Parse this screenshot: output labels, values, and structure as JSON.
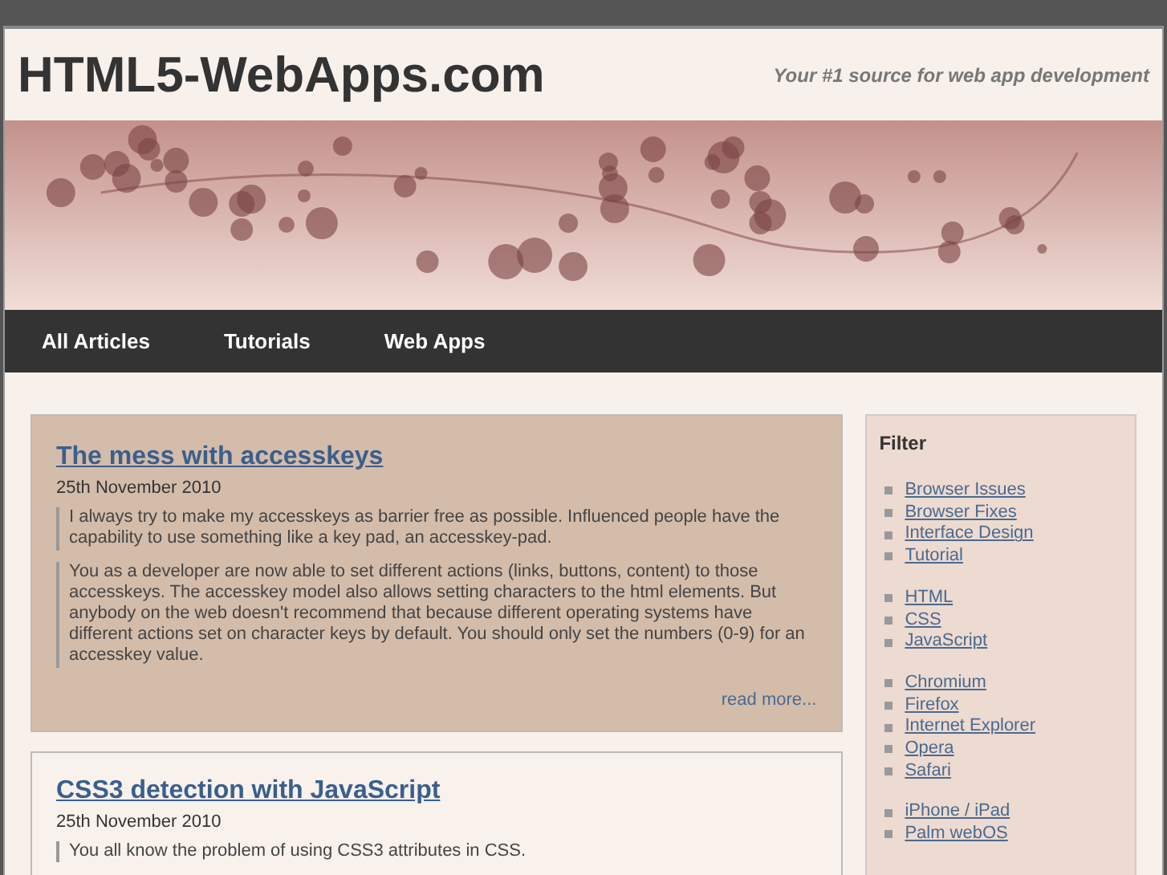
{
  "site": {
    "title": "HTML5-WebApps.com",
    "tagline": "Your #1 source for web app development"
  },
  "nav": [
    "All Articles",
    "Tutorials",
    "Web Apps"
  ],
  "articles": [
    {
      "title": "The mess with accesskeys",
      "date": "25th November 2010",
      "highlighted": true,
      "paragraphs": [
        "I always try to make my accesskeys as barrier free as possible. Influenced people have the capability to use something like a key pad, an accesskey-pad.",
        "You as a developer are now able to set different actions (links, buttons, content) to those accesskeys. The accesskey model also allows setting characters to the html elements. But anybody on the web doesn't recommend that because different operating systems have different actions set on character keys by default. You should only set the numbers (0-9) for an accesskey value."
      ],
      "read_more": "read more..."
    },
    {
      "title": "CSS3 detection with JavaScript",
      "date": "25th November 2010",
      "highlighted": false,
      "paragraphs": [
        "You all know the problem of using CSS3 attributes in CSS."
      ]
    }
  ],
  "filter": {
    "title": "Filter",
    "groups": [
      [
        "Browser Issues",
        "Browser Fixes",
        "Interface Design",
        "Tutorial"
      ],
      [
        "HTML",
        "CSS",
        "JavaScript"
      ],
      [
        "Chromium",
        "Firefox",
        "Internet Explorer",
        "Opera",
        "Safari"
      ],
      [
        "iPhone / iPad",
        "Palm webOS"
      ]
    ]
  }
}
